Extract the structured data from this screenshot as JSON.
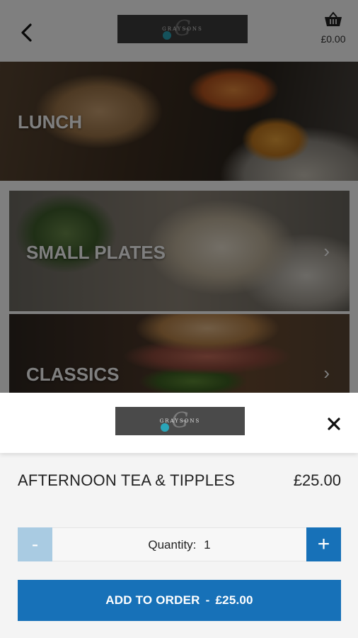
{
  "header": {
    "logo_text": "GRAYSONS",
    "logo_script": "G",
    "cart_total": "£0.00"
  },
  "categories": [
    {
      "label": "LUNCH"
    },
    {
      "label": "SMALL PLATES"
    },
    {
      "label": "CLASSICS"
    }
  ],
  "modal": {
    "logo_text": "GRAYSONS",
    "logo_script": "G",
    "product_name": "AFTERNOON TEA & TIPPLES",
    "product_price": "£25.00",
    "quantity_label": "Quantity:",
    "quantity_value": "1",
    "minus_label": "-",
    "plus_label": "+",
    "add_label": "ADD TO ORDER",
    "add_separator": "-",
    "add_price": "£25.00"
  },
  "colors": {
    "primary": "#1771b8",
    "primary_disabled": "#a9cbe2",
    "overlay": "rgba(0,0,0,0.5)"
  },
  "icons": {
    "back": "chevron-left-icon",
    "cart": "basket-icon",
    "close": "close-icon",
    "category_arrow": "chevron-right-icon"
  }
}
